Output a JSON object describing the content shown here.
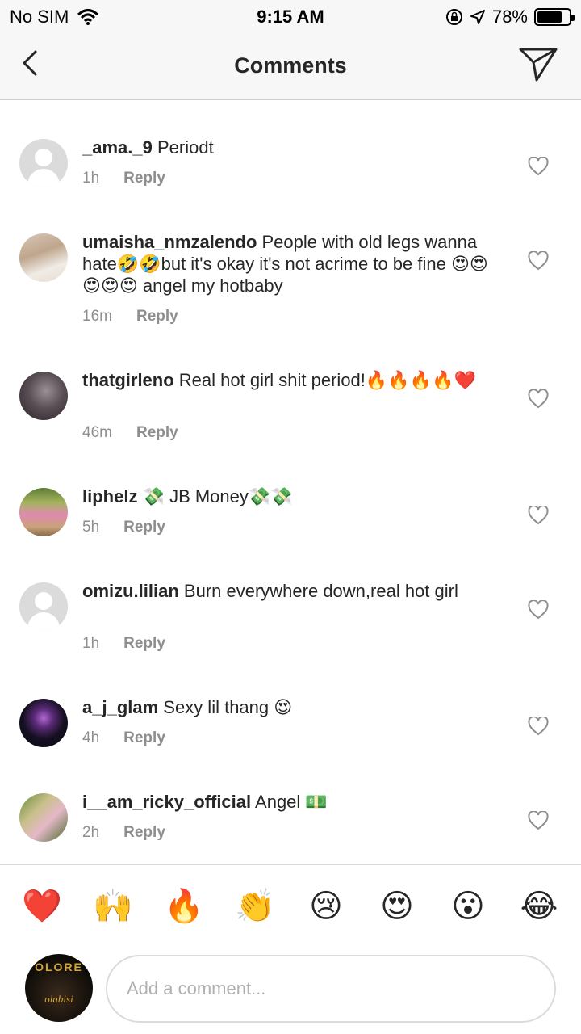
{
  "status_bar": {
    "carrier": "No SIM",
    "time": "9:15 AM",
    "battery_text": "78%",
    "battery_level": 0.78,
    "icons": [
      "wifi-icon",
      "orientation-lock-icon",
      "location-arrow-icon",
      "battery-icon"
    ]
  },
  "nav": {
    "title": "Comments",
    "back_icon": "chevron-left-icon",
    "send_icon": "paper-plane-icon"
  },
  "comments": [
    {
      "username": "_ama._9",
      "text": " Periodt",
      "time": "1h",
      "reply": "Reply",
      "avatar": "default"
    },
    {
      "username": "umaisha_nmzalendo",
      "text": " People with old legs wanna hate🤣🤣but it's okay it's not acrime to be fine 😍😍😍😍😍 angel my hotbaby",
      "time": "16m",
      "reply": "Reply",
      "avatar": "photo"
    },
    {
      "username": "thatgirleno",
      "text": " Real hot girl shit period!🔥🔥🔥🔥❤️",
      "time": "46m",
      "reply": "Reply",
      "avatar": "photo"
    },
    {
      "username": "liphelz",
      "text": " 💸 JB Money💸💸",
      "time": "5h",
      "reply": "Reply",
      "avatar": "photo"
    },
    {
      "username": "omizu.lilian",
      "text": " Burn everywhere down,real hot girl",
      "time": "1h",
      "reply": "Reply",
      "avatar": "default"
    },
    {
      "username": "a_j_glam",
      "text": " Sexy lil thang 😍",
      "time": "4h",
      "reply": "Reply",
      "avatar": "photo"
    },
    {
      "username": "i__am_ricky_official",
      "text": " Angel 💵",
      "time": "2h",
      "reply": "Reply",
      "avatar": "photo"
    }
  ],
  "emoji_bar": [
    "❤️",
    "🙌",
    "🔥",
    "👏",
    "😢",
    "😍",
    "😮",
    "😂"
  ],
  "composer": {
    "placeholder": "Add a comment...",
    "avatar_text": "OLORE",
    "avatar_sub": "olabisi"
  },
  "colors": {
    "text": "#262626",
    "secondary": "#8e8e8e",
    "divider": "#dbdbdb",
    "bar_bg": "#f7f7f7"
  }
}
